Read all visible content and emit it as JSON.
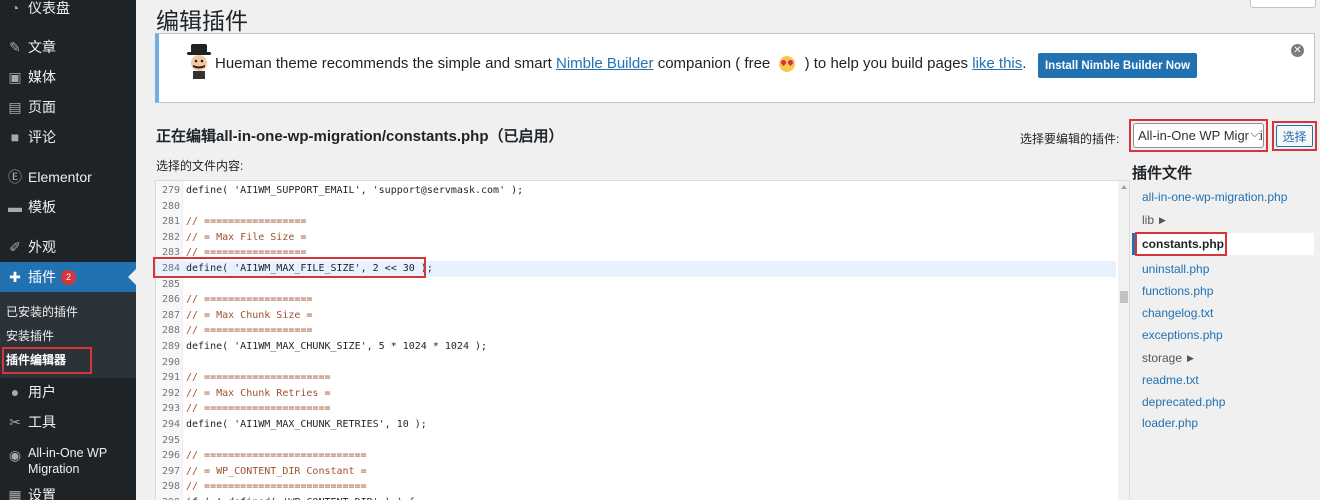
{
  "sidebar": {
    "items": [
      {
        "label": "仪表盘",
        "icon": "dashboard-icon"
      },
      {
        "label": "文章",
        "icon": "pin-icon"
      },
      {
        "label": "媒体",
        "icon": "media-icon"
      },
      {
        "label": "页面",
        "icon": "page-icon"
      },
      {
        "label": "评论",
        "icon": "comment-icon"
      },
      {
        "label": "Elementor",
        "icon": "elementor-icon"
      },
      {
        "label": "模板",
        "icon": "folder-icon"
      },
      {
        "label": "外观",
        "icon": "brush-icon"
      },
      {
        "label": "插件",
        "icon": "plugin-icon",
        "badge": "2"
      },
      {
        "label": "用户",
        "icon": "user-icon"
      },
      {
        "label": "工具",
        "icon": "wrench-icon"
      },
      {
        "label": "All-in-One WP Migration",
        "icon": "migration-icon"
      },
      {
        "label": "设置",
        "icon": "settings-icon"
      }
    ],
    "submenu": [
      "已安装的插件",
      "安装插件",
      "插件编辑器"
    ]
  },
  "page_title": "编辑插件",
  "notice": {
    "text_before": "Hueman theme recommends the simple and smart ",
    "link1": "Nimble Builder",
    "text_mid1": " companion ( free ",
    "text_mid2": " ) to help you build pages ",
    "link2": "like this",
    "text_after": ".",
    "install_button": "Install Nimble Builder Now",
    "dismiss_icon": "close-circle-icon"
  },
  "editing_title": "正在编辑all-in-one-wp-migration/constants.php（已启用）",
  "select_file_label": "选择的文件内容:",
  "select_plugin_label": "选择要编辑的插件:",
  "plugin_select_value": "All-in-One WP Migration",
  "select_button": "选择",
  "files_heading": "插件文件",
  "files": [
    {
      "name": "all-in-one-wp-migration.php",
      "type": "file"
    },
    {
      "name": "lib",
      "type": "folder"
    },
    {
      "name": "constants.php",
      "type": "current"
    },
    {
      "name": "uninstall.php",
      "type": "file"
    },
    {
      "name": "functions.php",
      "type": "file"
    },
    {
      "name": "changelog.txt",
      "type": "file"
    },
    {
      "name": "exceptions.php",
      "type": "file"
    },
    {
      "name": "storage",
      "type": "folder"
    },
    {
      "name": "readme.txt",
      "type": "file"
    },
    {
      "name": "deprecated.php",
      "type": "file"
    },
    {
      "name": "loader.php",
      "type": "file"
    }
  ],
  "code_lines": [
    {
      "n": "279",
      "t": "define( 'AI1WM_SUPPORT_EMAIL', 'support@servmask.com' );"
    },
    {
      "n": "280",
      "t": ""
    },
    {
      "n": "281",
      "t": "// ================="
    },
    {
      "n": "282",
      "t": "// = Max File Size ="
    },
    {
      "n": "283",
      "t": "// ================="
    },
    {
      "n": "284",
      "t": "define( 'AI1WM_MAX_FILE_SIZE', 2 << 30 );"
    },
    {
      "n": "285",
      "t": ""
    },
    {
      "n": "286",
      "t": "// =================="
    },
    {
      "n": "287",
      "t": "// = Max Chunk Size ="
    },
    {
      "n": "288",
      "t": "// =================="
    },
    {
      "n": "289",
      "t": "define( 'AI1WM_MAX_CHUNK_SIZE', 5 * 1024 * 1024 );"
    },
    {
      "n": "290",
      "t": ""
    },
    {
      "n": "291",
      "t": "// ====================="
    },
    {
      "n": "292",
      "t": "// = Max Chunk Retries ="
    },
    {
      "n": "293",
      "t": "// ====================="
    },
    {
      "n": "294",
      "t": "define( 'AI1WM_MAX_CHUNK_RETRIES', 10 );"
    },
    {
      "n": "295",
      "t": ""
    },
    {
      "n": "296",
      "t": "// ==========================="
    },
    {
      "n": "297",
      "t": "// = WP_CONTENT_DIR Constant ="
    },
    {
      "n": "298",
      "t": "// ==========================="
    },
    {
      "n": "299",
      "t": "if ( ! defined( 'WP_CONTENT_DIR' ) ) {"
    }
  ],
  "highlight_line": "284",
  "colors": {
    "sidebar_bg": "#1d2327",
    "accent": "#2271b1",
    "annotation_red": "#d63638"
  }
}
